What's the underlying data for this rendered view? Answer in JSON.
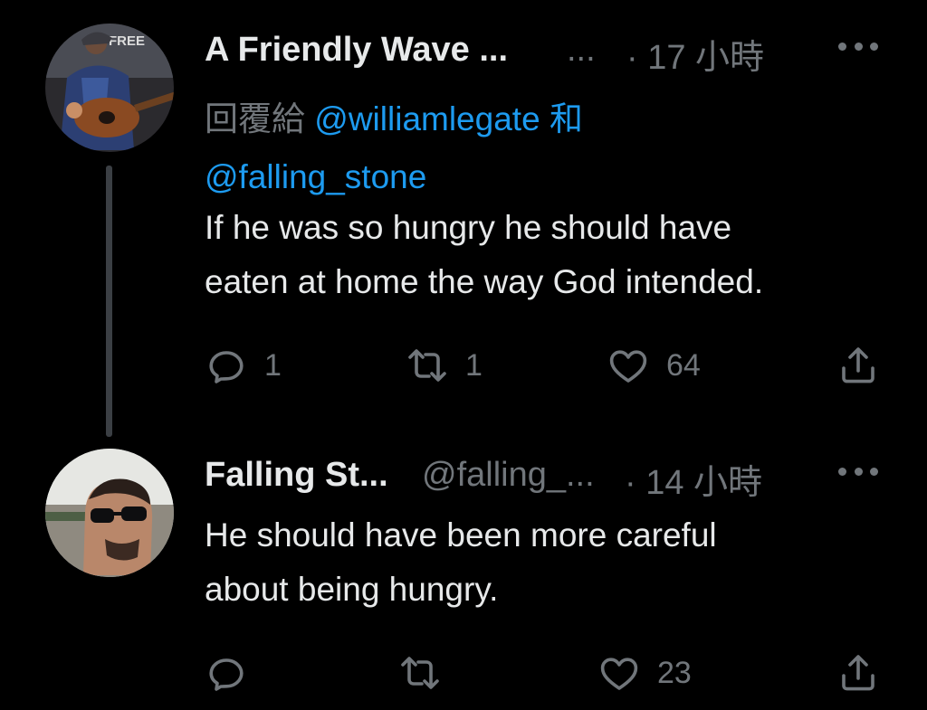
{
  "tweets": [
    {
      "display_name": "A Friendly Wave ...",
      "handle": "...",
      "time": "· 17 小時",
      "reply_prefix": "回覆給",
      "reply_mention_1": "@williamlegate",
      "reply_joiner": "和",
      "reply_mention_2": "@falling_stone",
      "text": "If he was so hungry he should have\neaten at home the way God intended.",
      "reply_count": "1",
      "retweet_count": "1",
      "like_count": "64",
      "avatar_icon": "guitar-player-avatar-icon",
      "avatar_text": "FREE"
    },
    {
      "display_name": "Falling St...",
      "handle": "@falling_...",
      "time": "· 14 小時",
      "text": "He should have been more careful\nabout being hungry.",
      "reply_count": "",
      "retweet_count": "",
      "like_count": "23",
      "avatar_icon": "sunglasses-man-avatar-icon"
    }
  ],
  "colors": {
    "background": "#000000",
    "text_primary": "#e7e9ea",
    "text_secondary": "#71767b",
    "link": "#1d9bf0",
    "thread_line": "#3b3f44"
  }
}
